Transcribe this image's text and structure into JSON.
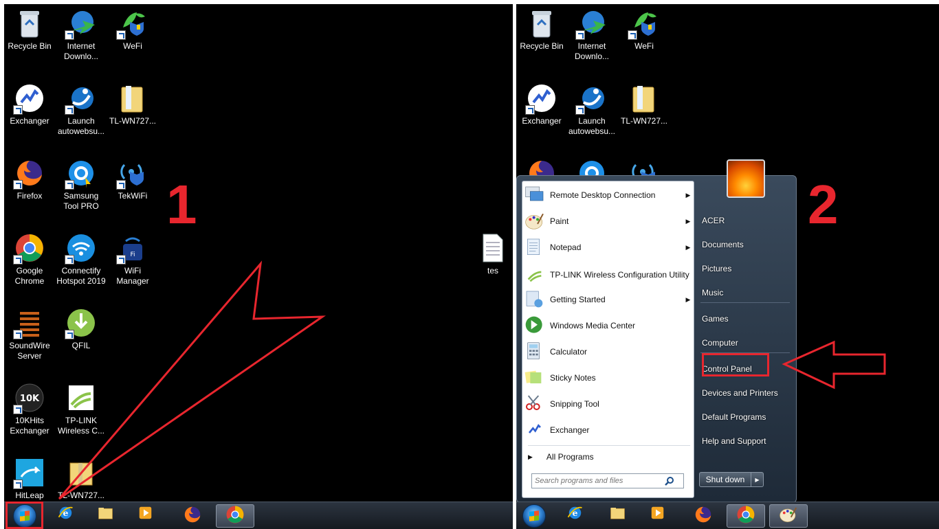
{
  "panel_1": {
    "step_number": "1",
    "desktop_icons": [
      {
        "label": "Recycle Bin",
        "icon": "recycle-bin-icon"
      },
      {
        "label": "Internet\nDownlo...",
        "icon": "internet-download-manager-icon"
      },
      {
        "label": "WeFi",
        "icon": "wefi-icon"
      },
      {
        "label": "Exchanger",
        "icon": "exchanger-icon"
      },
      {
        "label": "Launch\nautowebsu...",
        "icon": "launch-autowebsurf-icon"
      },
      {
        "label": "TL-WN727...",
        "icon": "folder-icon"
      },
      {
        "label": "Firefox",
        "icon": "firefox-icon"
      },
      {
        "label": "Samsung\nTool PRO",
        "icon": "samsung-tool-pro-icon"
      },
      {
        "label": "TekWiFi",
        "icon": "tekwifi-icon"
      },
      {
        "label": "Google\nChrome",
        "icon": "chrome-icon"
      },
      {
        "label": "Connectify\nHotspot 2019",
        "icon": "connectify-icon"
      },
      {
        "label": "WiFi\nManager",
        "icon": "wifi-manager-icon"
      },
      {
        "label": "SoundWire\nServer",
        "icon": "soundwire-icon"
      },
      {
        "label": "QFIL",
        "icon": "qfil-icon"
      },
      {
        "label": "10KHits\nExchanger",
        "icon": "10khits-icon"
      },
      {
        "label": "TP-LINK\nWireless C...",
        "icon": "tp-link-icon"
      },
      {
        "label": "HitLeap",
        "icon": "hitleap-icon"
      },
      {
        "label": "TL-WN727...",
        "icon": "folder-zip-icon"
      },
      {
        "label": "tes",
        "icon": "text-file-icon"
      }
    ]
  },
  "panel_2": {
    "step_number": "2",
    "desktop_icons": [
      {
        "label": "Recycle Bin"
      },
      {
        "label": "Internet\nDownlo..."
      },
      {
        "label": "WeFi"
      },
      {
        "label": "Exchanger"
      },
      {
        "label": "Launch\nautowebsu..."
      },
      {
        "label": "TL-WN727..."
      }
    ],
    "start_menu": {
      "programs": [
        {
          "label": "Remote Desktop Connection",
          "icon": "remote-desktop-icon",
          "has_submenu": true
        },
        {
          "label": "Paint",
          "icon": "paint-icon",
          "has_submenu": true
        },
        {
          "label": "Notepad",
          "icon": "notepad-icon",
          "has_submenu": true
        },
        {
          "label": "TP-LINK Wireless Configuration Utility",
          "icon": "tp-link-icon",
          "has_submenu": false
        },
        {
          "label": "Getting Started",
          "icon": "getting-started-icon",
          "has_submenu": true
        },
        {
          "label": "Windows Media Center",
          "icon": "media-center-icon",
          "has_submenu": false
        },
        {
          "label": "Calculator",
          "icon": "calculator-icon",
          "has_submenu": false
        },
        {
          "label": "Sticky Notes",
          "icon": "sticky-notes-icon",
          "has_submenu": false
        },
        {
          "label": "Snipping Tool",
          "icon": "snipping-tool-icon",
          "has_submenu": false
        },
        {
          "label": "Exchanger",
          "icon": "exchanger-icon",
          "has_submenu": false
        }
      ],
      "all_programs": "All Programs",
      "search_placeholder": "Search programs and files",
      "right_links": {
        "user": "ACER",
        "documents": "Documents",
        "pictures": "Pictures",
        "music": "Music",
        "games": "Games",
        "computer": "Computer",
        "control_panel": "Control Panel",
        "devices_printers": "Devices and Printers",
        "default_programs": "Default Programs",
        "help_support": "Help and Support"
      },
      "shutdown": "Shut down"
    }
  },
  "taskbar": {
    "pinned": [
      "internet-explorer-icon",
      "explorer-folder-icon",
      "media-player-icon",
      "firefox-icon",
      "chrome-icon"
    ],
    "panel_2_extra": "paint-icon"
  },
  "colors": {
    "annotation_red": "#e8262e",
    "desktop_bg": "#000000"
  }
}
